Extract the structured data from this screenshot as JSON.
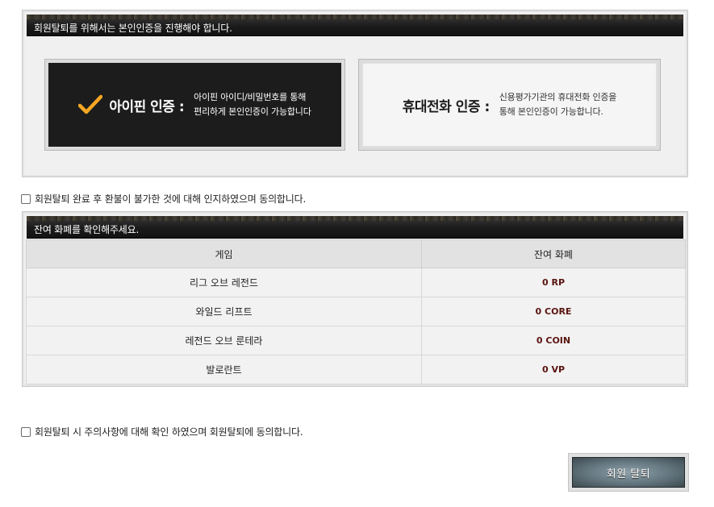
{
  "verify": {
    "title": "회원탈퇴를 위해서는 본인인증을 진행해야 합니다.",
    "ipin": {
      "label": "아이핀 인증 :",
      "desc": "아이핀 아이디/비밀번호를 통해\n편리하게 본인인증이 가능합니다"
    },
    "phone": {
      "label": "휴대전화 인증 :",
      "desc": "신용평가기관의 휴대전화 인증을\n통해 본인인증이 가능합니다."
    }
  },
  "agree_refund": "회원탈퇴 완료 후 환불이 불가한 것에 대해 인지하였으며 동의합니다.",
  "currency": {
    "title": "잔여 화폐를 확인해주세요.",
    "headers": [
      "게임",
      "잔여 화폐"
    ],
    "rows": [
      {
        "game": "리그 오브 레전드",
        "amount": "0 RP"
      },
      {
        "game": "와일드 리프트",
        "amount": "0 CORE"
      },
      {
        "game": "레전드 오브 룬테라",
        "amount": "0 COIN"
      },
      {
        "game": "발로란트",
        "amount": "0 VP"
      }
    ]
  },
  "agree_notice": "회원탈퇴 시 주의사항에 대해 확인 하였으며 회원탈퇴에 동의합니다.",
  "withdraw_label": "회원 탈퇴",
  "colors": {
    "accent_check": "#f5a623",
    "amount_text": "#5a1410",
    "header_dark": "#1b1b1b"
  },
  "icons": {
    "ipin_check": "check-icon"
  }
}
